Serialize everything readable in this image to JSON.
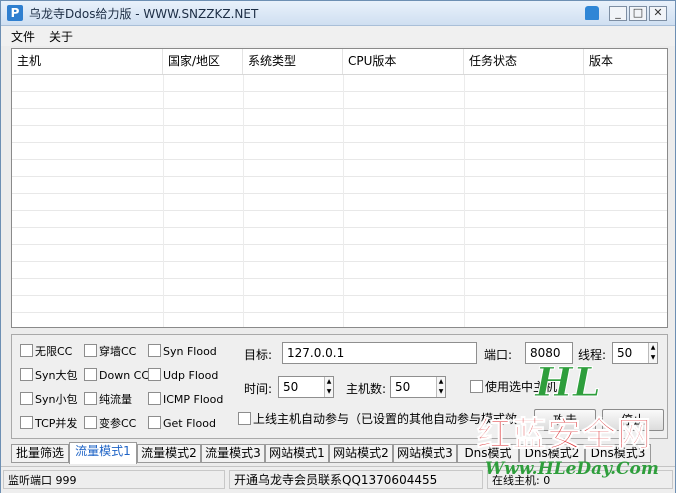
{
  "window": {
    "title": "乌龙寺Ddos给力版 - WWW.SNZZKZ.NET"
  },
  "menu": [
    "文件",
    "关于"
  ],
  "table": {
    "columns": [
      "主机",
      "国家/地区",
      "系统类型",
      "CPU版本",
      "任务状态",
      "版本"
    ]
  },
  "options": {
    "col1": [
      "无限CC",
      "Syn大包",
      "Syn小包",
      "TCP并发"
    ],
    "col2": [
      "穿墙CC",
      "Down CC",
      "纯流量",
      "变参CC"
    ],
    "col3": [
      "Syn Flood",
      "Udp Flood",
      "ICMP Flood",
      "Get Flood"
    ]
  },
  "form": {
    "target_label": "目标:",
    "target_value": "127.0.0.1",
    "port_label": "端口:",
    "port_value": "8080",
    "threads_label": "线程:",
    "threads_value": "50",
    "time_label": "时间:",
    "time_value": "50",
    "hosts_label": "主机数:",
    "hosts_value": "50",
    "use_selected_label": "使用选中主机",
    "auto_join_label": "上线主机自动参与（已设置的其他自动参与模式效",
    "start_label": "攻击",
    "stop_label": "停止"
  },
  "tabs": [
    "批量筛选",
    "流量模式1",
    "流量模式2",
    "流量模式3",
    "网站模式1",
    "网站模式2",
    "网站模式3",
    "Dns模式",
    "Dns模式2",
    "Dns模式3"
  ],
  "active_tab": 1,
  "status": {
    "port_text": "监听端口 999",
    "contact_text": "开通乌龙寺会员联系QQ1370604455",
    "right_text": "在线主机: 0"
  },
  "watermark": {
    "line1": "HL",
    "line2": "红蓝安全网",
    "line3": "Www.HLeDay.Com"
  },
  "colors": {
    "accent": "#1e63c6",
    "watermark_red": "#d8262a",
    "watermark_green": "#2e9e3c"
  }
}
